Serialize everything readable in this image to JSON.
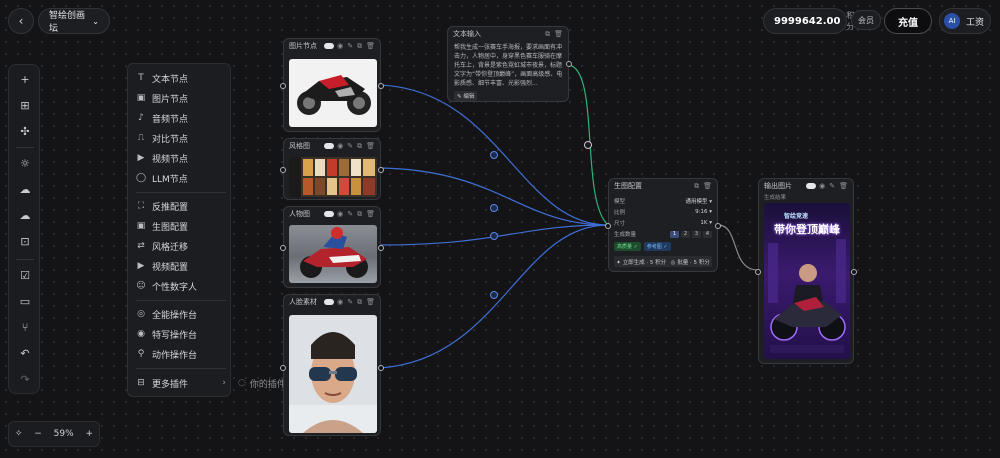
{
  "header": {
    "project_name": "智绘创画坛",
    "balance": "9999642.00",
    "balance_unit": "积分",
    "vip_label": "会员",
    "recharge_label": "充值",
    "user_label": "工资",
    "avatar_text": "AI"
  },
  "menu": {
    "items": [
      {
        "icon": "T",
        "label": "文本节点"
      },
      {
        "icon": "▣",
        "label": "图片节点"
      },
      {
        "icon": "♪",
        "label": "音频节点"
      },
      {
        "icon": "⎍",
        "label": "对比节点"
      },
      {
        "icon": "▶",
        "label": "视频节点"
      },
      {
        "icon": "◯",
        "label": "LLM节点"
      },
      {
        "icon": "⛶",
        "label": "反推配置"
      },
      {
        "icon": "▣",
        "label": "生图配置"
      },
      {
        "icon": "⇄",
        "label": "风格迁移"
      },
      {
        "icon": "▶",
        "label": "视频配置"
      },
      {
        "icon": "☺",
        "label": "个性数字人"
      },
      {
        "icon": "◎",
        "label": "全能操作台"
      },
      {
        "icon": "◉",
        "label": "特写操作台"
      },
      {
        "icon": "⚲",
        "label": "动作操作台"
      },
      {
        "icon": "⊟",
        "label": "更多插件"
      }
    ],
    "submenu_label": "你的插件节点"
  },
  "zoom": {
    "minus": "−",
    "value": "59%",
    "plus": "+"
  },
  "nodes": {
    "img1": {
      "title": "图片节点",
      "image_desc": "red-black racing motorcycle"
    },
    "img2": {
      "title": "风格图",
      "image_desc": "poster grid"
    },
    "img3": {
      "title": "人物图",
      "image_desc": "rider on track"
    },
    "img4": {
      "title": "人脸素材",
      "image_desc": "portrait with sunglasses"
    },
    "text": {
      "title": "文本输入",
      "content": "帮我生成一张赛车手海报，要求画面有冲击力，人物居中，身穿黑色赛车服骑在摩托车上，背景是紫色霓虹城市夜景，标题文字为“带你登顶巅峰”，画面高级感、电影质感、细节丰富、光影强烈...",
      "tag": "✎ 编辑"
    },
    "config": {
      "title": "生图配置",
      "rows": [
        {
          "label": "模型",
          "value": "通用模型 ▾"
        },
        {
          "label": "比例",
          "value": "9:16 ▾"
        },
        {
          "label": "尺寸",
          "value": "1K ▾"
        }
      ],
      "count_label": "生成数量",
      "counts": [
        "1",
        "2",
        "3",
        "4"
      ],
      "chips": [
        "高质量 ✓",
        "参考图 ✓"
      ],
      "buttons": [
        "✦ 立即生成 · 5 积分",
        "◎ 批量 · 5 积分"
      ]
    },
    "output": {
      "title": "输出图片",
      "sub_label": "生成结果",
      "poster_title": "带你登顶巅峰",
      "poster_small": "智绘竞速"
    }
  },
  "colors": {
    "wire_blue": "#3f6fd6",
    "wire_green": "#2fb37a",
    "accent": "#7a4fd8"
  }
}
